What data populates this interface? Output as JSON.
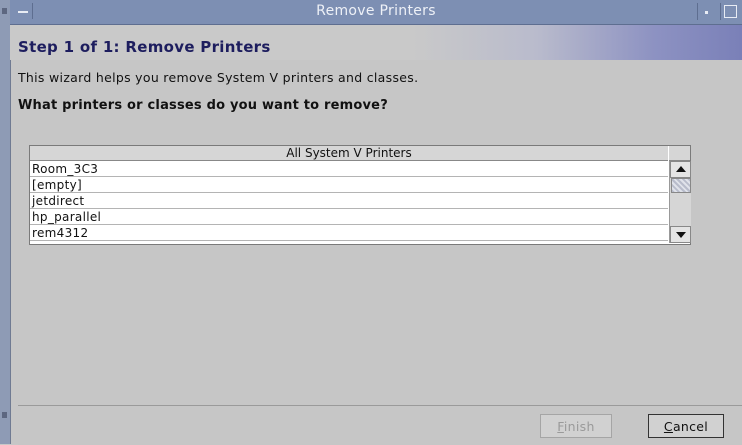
{
  "window": {
    "title": "Remove Printers"
  },
  "step": {
    "title": "Step 1 of 1: Remove Printers"
  },
  "description": "This wizard helps you remove System V printers and classes.",
  "question": "What printers or classes do you want to remove?",
  "table": {
    "header": "All System V Printers",
    "rows": [
      "Room_3C3",
      "[empty]",
      "jetdirect",
      "hp_parallel",
      "rem4312"
    ]
  },
  "buttons": {
    "finish": {
      "mnemonic": "F",
      "rest": "inish",
      "enabled": false
    },
    "cancel": {
      "mnemonic": "C",
      "rest": "ancel",
      "enabled": true
    }
  },
  "icons": {
    "window_menu": "window-menu-icon",
    "minimize": "minimize-icon",
    "maximize": "maximize-icon",
    "scroll_up": "scroll-up-arrow-icon",
    "scroll_down": "scroll-down-arrow-icon"
  },
  "colors": {
    "titlebar": "#7d8fb3",
    "step_title": "#1d1d5e",
    "window_bg": "#c6c6c6"
  }
}
